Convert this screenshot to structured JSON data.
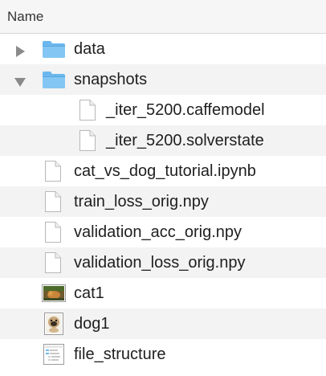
{
  "header": {
    "column_name": "Name"
  },
  "rows": [
    {
      "name": "data",
      "kind": "folder",
      "level": 0,
      "disclosure": "collapsed"
    },
    {
      "name": "snapshots",
      "kind": "folder",
      "level": 0,
      "disclosure": "expanded"
    },
    {
      "name": "_iter_5200.caffemodel",
      "kind": "document",
      "level": 1
    },
    {
      "name": "_iter_5200.solverstate",
      "kind": "document",
      "level": 1
    },
    {
      "name": "cat_vs_dog_tutorial.ipynb",
      "kind": "document",
      "level": 0
    },
    {
      "name": "train_loss_orig.npy",
      "kind": "document",
      "level": 0
    },
    {
      "name": "validation_acc_orig.npy",
      "kind": "document",
      "level": 0
    },
    {
      "name": "validation_loss_orig.npy",
      "kind": "document",
      "level": 0
    },
    {
      "name": "cat1",
      "kind": "image-cat",
      "level": 0
    },
    {
      "name": "dog1",
      "kind": "image-dog",
      "level": 0
    },
    {
      "name": "file_structure",
      "kind": "image-screenshot",
      "level": 0
    }
  ],
  "colors": {
    "folder": "#6bb7ee",
    "folder_tab": "#84c6f3",
    "disclosure": "#8a8a8a",
    "stripe": "#f3f3f3"
  },
  "icons": {
    "folder": "folder-icon",
    "document": "document-icon",
    "image-cat": "cat-thumbnail-icon",
    "image-dog": "dog-thumbnail-icon",
    "image-screenshot": "screenshot-thumbnail-icon",
    "collapsed": "disclosure-triangle-right-icon",
    "expanded": "disclosure-triangle-down-icon"
  }
}
